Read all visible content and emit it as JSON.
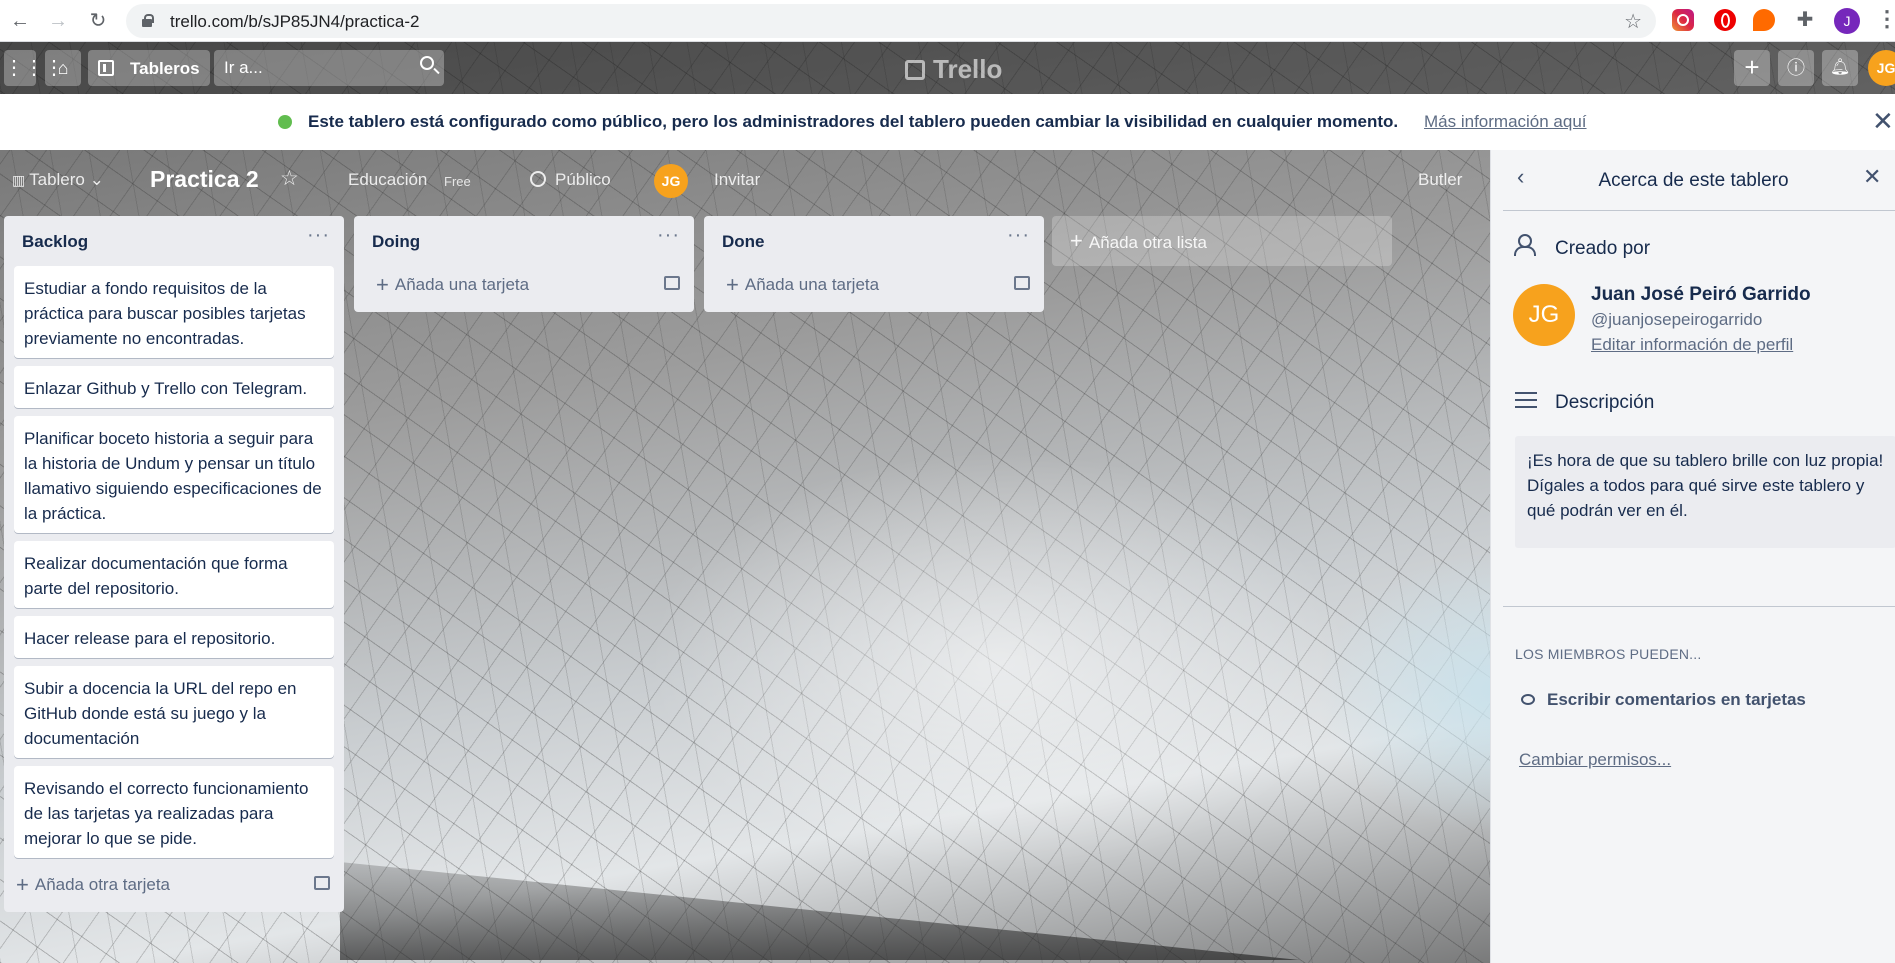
{
  "browser": {
    "url": "trello.com/b/sJP85JN4/practica-2",
    "profile_initial": "J"
  },
  "header": {
    "boards_label": "Tableros",
    "search_placeholder": "Ir a...",
    "logo_text": "Trello",
    "user_initials": "JG"
  },
  "banner": {
    "text": "Este tablero está configurado como público, pero los administradores del tablero pueden cambiar la visibilidad en cualquier momento.",
    "link": "Más información aquí"
  },
  "board": {
    "view_label": "Tablero",
    "title": "Practica 2",
    "team": "Educación",
    "plan": "Free",
    "visibility": "Público",
    "member_initials": "JG",
    "invite": "Invitar",
    "butler": "Butler"
  },
  "lists": [
    {
      "title": "Backlog",
      "cards": [
        "Estudiar a fondo requisitos de la práctica para buscar posibles tarjetas previamente no encontradas.",
        "Enlazar Github y Trello con Telegram.",
        "Planificar boceto historia a seguir para la historia de Undum y pensar un título llamativo siguiendo especificaciones de la práctica.",
        "Realizar documentación que forma parte del repositorio.",
        "Hacer release para el repositorio.",
        "Subir a docencia la URL del repo en GitHub donde está su juego y la documentación",
        "Revisando el correcto funcionamiento de las tarjetas ya realizadas para mejorar lo que se pide."
      ],
      "add_label": "Añada otra tarjeta"
    },
    {
      "title": "Doing",
      "cards": [],
      "add_label": "Añada una tarjeta"
    },
    {
      "title": "Done",
      "cards": [],
      "add_label": "Añada una tarjeta"
    }
  ],
  "add_list_label": "Añada otra lista",
  "panel": {
    "title": "Acerca de este tablero",
    "creator_heading": "Creado por",
    "creator_initials": "JG",
    "creator_name": "Juan José Peiró Garrido",
    "creator_username": "@juanjosepeirogarrido",
    "edit_profile": "Editar información de perfil",
    "description_heading": "Descripción",
    "description": "¡Es hora de que su tablero brille con luz propia! Dígales a todos para qué sirve este tablero y qué podrán ver en él.",
    "members_heading": "Los miembros pueden...",
    "permission": "Escribir comentarios en tarjetas",
    "change_permissions": "Cambiar permisos..."
  }
}
